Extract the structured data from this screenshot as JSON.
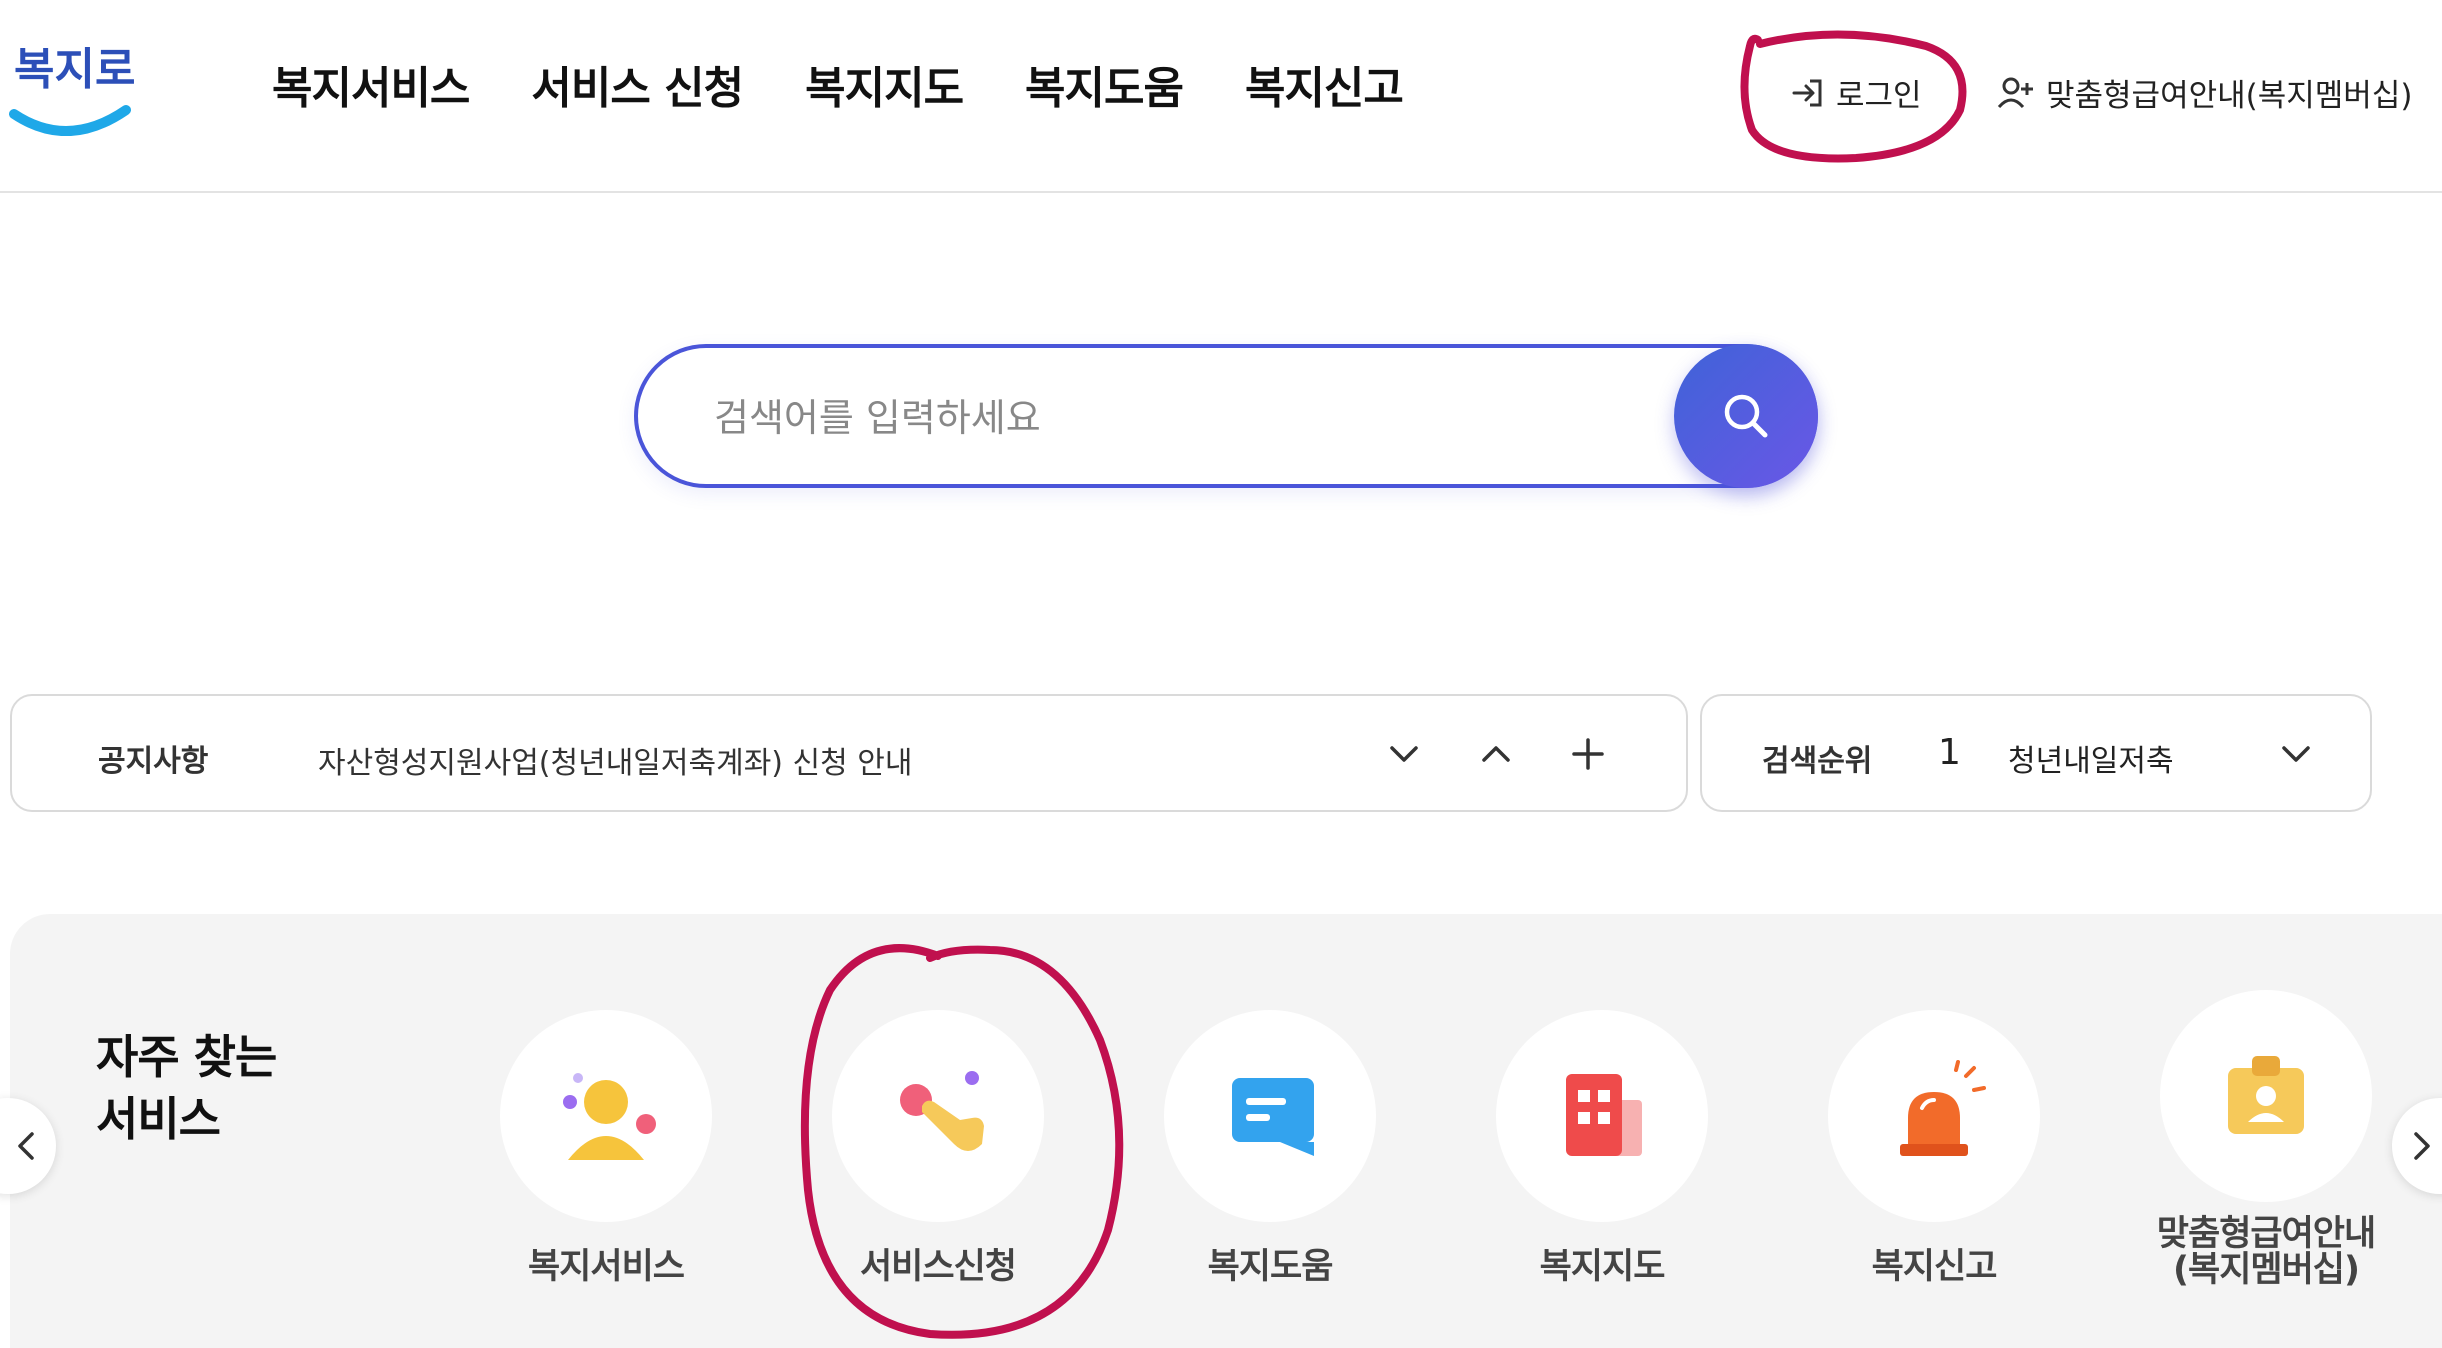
{
  "header": {
    "top_util": [
      "",
      "",
      "",
      "",
      ""
    ],
    "logo_alt": "복지로",
    "gnb": [
      "복지서비스",
      "서비스 신청",
      "복지지도",
      "복지도움",
      "복지신고"
    ],
    "login_label": "로그인",
    "membership_label": "맞춤형급여안내(복지멤버십)"
  },
  "search": {
    "placeholder": "검색어를 입력하세요",
    "value": ""
  },
  "notice": {
    "label": "공지사항",
    "text": "자산형성지원사업(청년내일저축계좌) 신청 안내"
  },
  "ranking": {
    "label": "검색순위",
    "rank": "1",
    "keyword": "청년내일저축"
  },
  "frequent": {
    "title_line1": "자주 찾는",
    "title_line2": "서비스",
    "items": [
      {
        "label": "복지서비스",
        "icon": "person-icon"
      },
      {
        "label": "서비스신청",
        "icon": "tap-hand-icon"
      },
      {
        "label": "복지도움",
        "icon": "chat-card-icon"
      },
      {
        "label": "복지지도",
        "icon": "building-icon"
      },
      {
        "label": "복지신고",
        "icon": "siren-icon"
      },
      {
        "label_line1": "맞춤형급여안내",
        "label_line2": "(복지멤버십)",
        "icon": "id-card-icon"
      }
    ]
  },
  "colors": {
    "accent": "#4a55d9",
    "annotation": "#c0104e",
    "logo_blue": "#1fa8e8",
    "logo_text": "#2c4fb8"
  }
}
